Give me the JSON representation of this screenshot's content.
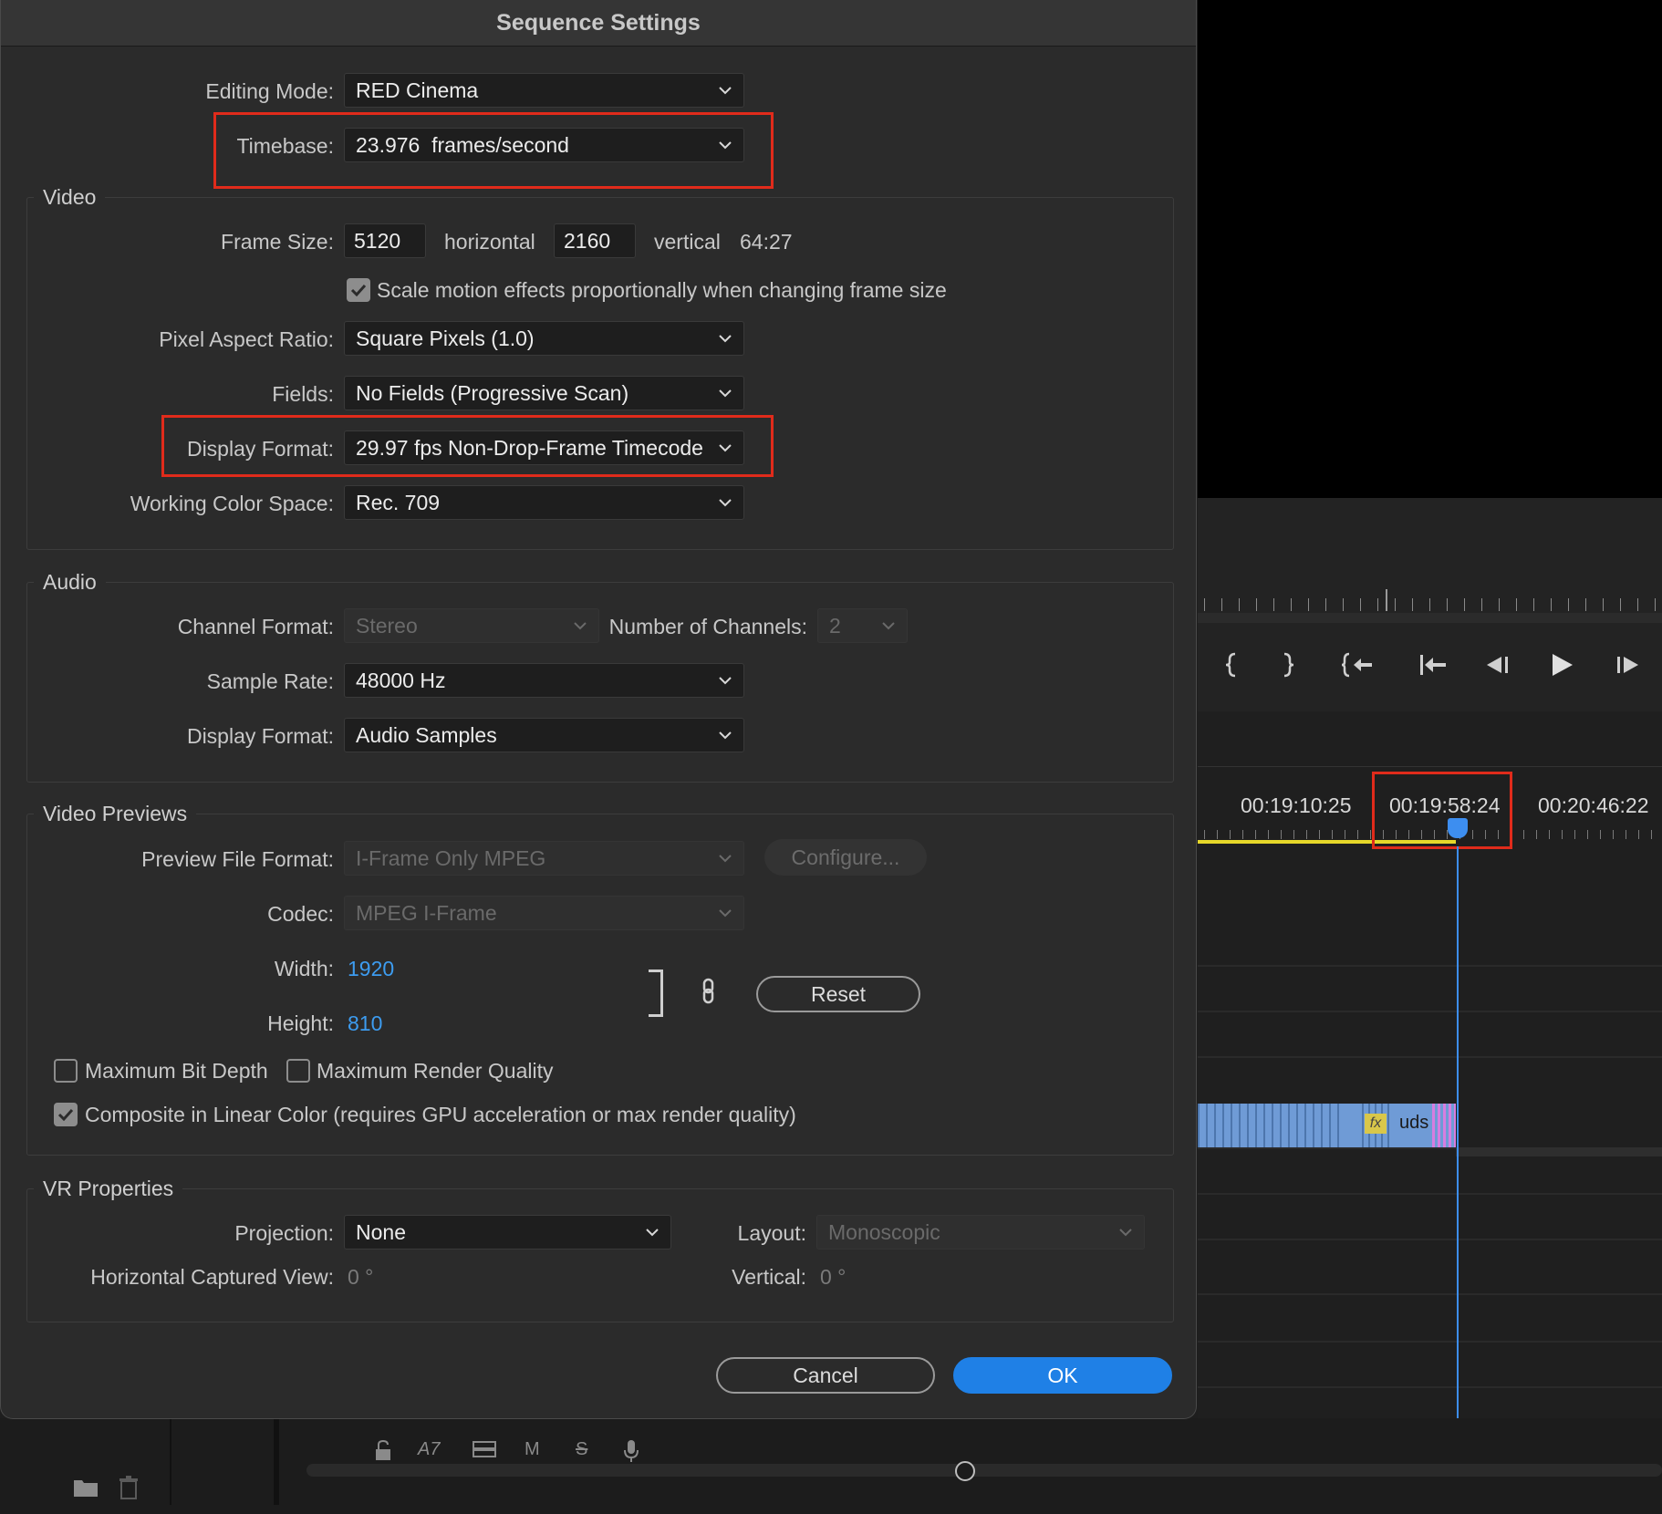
{
  "dialog": {
    "title": "Sequence Settings",
    "editing_mode": {
      "label": "Editing Mode:",
      "value": "RED Cinema"
    },
    "timebase": {
      "label": "Timebase:",
      "value": "23.976  frames/second"
    },
    "video": {
      "title": "Video",
      "frame_size_label": "Frame Size:",
      "width": "5120",
      "horizontal_label": "horizontal",
      "height": "2160",
      "vertical_label": "vertical",
      "aspect": "64:27",
      "scale_motion_label": "Scale motion effects proportionally when changing frame size",
      "scale_motion_checked": true,
      "pixel_aspect": {
        "label": "Pixel Aspect Ratio:",
        "value": "Square Pixels (1.0)"
      },
      "fields": {
        "label": "Fields:",
        "value": "No Fields (Progressive Scan)"
      },
      "display_format": {
        "label": "Display Format:",
        "value": "29.97 fps Non-Drop-Frame Timecode"
      },
      "color_space": {
        "label": "Working Color Space:",
        "value": "Rec. 709"
      }
    },
    "audio": {
      "title": "Audio",
      "channel_format": {
        "label": "Channel Format:",
        "value": "Stereo"
      },
      "num_channels": {
        "label": "Number of Channels:",
        "value": "2"
      },
      "sample_rate": {
        "label": "Sample Rate:",
        "value": "48000 Hz"
      },
      "display_format": {
        "label": "Display Format:",
        "value": "Audio Samples"
      }
    },
    "previews": {
      "title": "Video Previews",
      "file_format": {
        "label": "Preview File Format:",
        "value": "I-Frame Only MPEG"
      },
      "configure_label": "Configure...",
      "codec": {
        "label": "Codec:",
        "value": "MPEG I-Frame"
      },
      "width_label": "Width:",
      "width_value": "1920",
      "height_label": "Height:",
      "height_value": "810",
      "reset_label": "Reset",
      "max_bit_depth_label": "Maximum Bit Depth",
      "max_render_quality_label": "Maximum Render Quality",
      "composite_label": "Composite in Linear Color (requires GPU acceleration or max render quality)",
      "composite_checked": true
    },
    "vr": {
      "title": "VR Properties",
      "projection": {
        "label": "Projection:",
        "value": "None"
      },
      "layout": {
        "label": "Layout:",
        "value": "Monoscopic"
      },
      "hcv_label": "Horizontal Captured View:",
      "hcv_value": "0 °",
      "vertical_label": "Vertical:",
      "vertical_value": "0 °"
    },
    "cancel_label": "Cancel",
    "ok_label": "OK"
  },
  "timeline": {
    "timecodes": [
      "00:19:10:25",
      "00:19:58:24",
      "00:20:46:22"
    ],
    "clip_label": "uds",
    "fx_label": "fx",
    "track_label": "A7",
    "mute_label": "M",
    "solo_label": "S"
  },
  "colors": {
    "accent_blue": "#1f80e6",
    "highlight_red": "#e02b1b",
    "playhead": "#3d8ef0",
    "in_out_bar": "#e6d82a",
    "clip": "#6f9bd6",
    "clip_end": "#d77ee0"
  }
}
